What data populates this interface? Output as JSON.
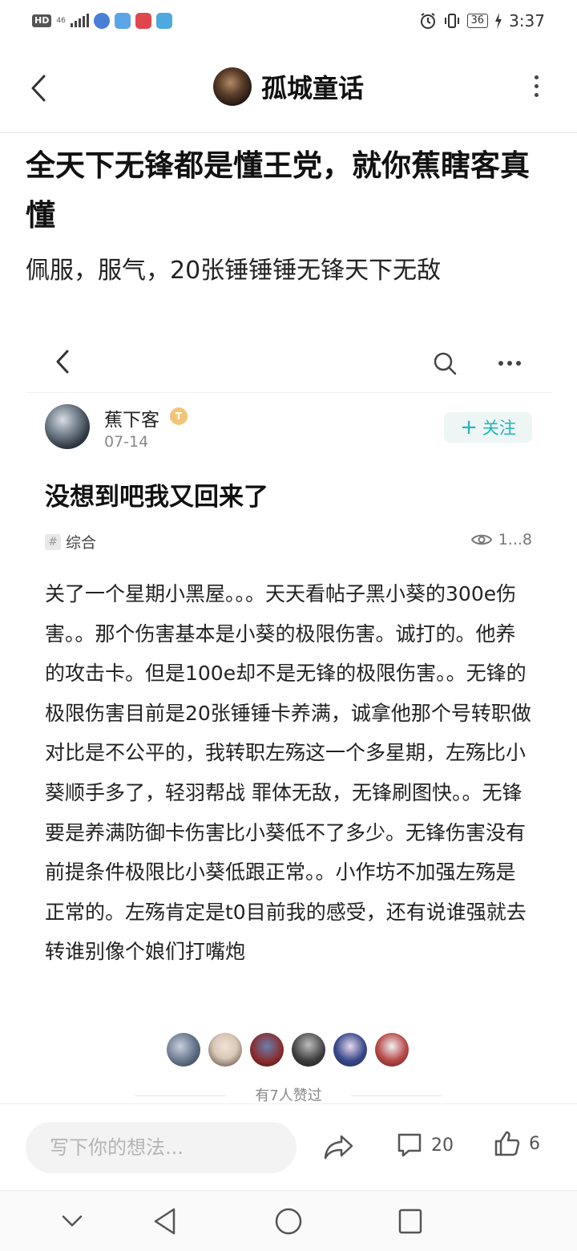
{
  "status_bar": {
    "hd": "HD",
    "network": "46",
    "battery": "36",
    "time": "3:37",
    "app_icon_colors": [
      "#4a7fd8",
      "#5aa6e6",
      "#e0474c",
      "#4fa8e0"
    ]
  },
  "header": {
    "title": "孤城童话"
  },
  "post": {
    "title": "全天下无锋都是懂王党，就你蕉瞎客真懂",
    "subtitle": "佩服，服气，20张锤锤锤无锋天下无敌"
  },
  "embedded": {
    "author": "蕉下客",
    "author_badge": "T5",
    "date": "07-14",
    "follow_label": "关注",
    "title": "没想到吧我又回来了",
    "tag": "综合",
    "views": "1...8",
    "body": "关了一个星期小黑屋。。。天天看帖子黑小葵的300e伤害。。那个伤害基本是小葵的极限伤害。诚打的。他养的攻击卡。但是100e却不是无锋的极限伤害。。无锋的极限伤害目前是20张锤锤卡养满，诚拿他那个号转职做对比是不公平的，我转职左殇这一个多星期，左殇比小葵顺手多了，轻羽帮战 罪体无敌，无锋刷图快。。无锋要是养满防御卡伤害比小葵低不了多少。无锋伤害没有前提条件极限比小葵低跟正常。。小作坊不加强左殇是正常的。左殇肯定是t0目前我的感受，还有说谁强就去转谁别像个娘们打嘴炮",
    "liked_text": "有7人赞过",
    "liker_colors": [
      "#5b6a80",
      "#d9c8b8",
      "#8a2a2a",
      "#3b3b3b",
      "#3a4a8a",
      "#b84848"
    ]
  },
  "bottom_bar": {
    "input_placeholder": "写下你的想法...",
    "comment_count": "20",
    "like_count": "6"
  },
  "icons": {
    "back": "back-arrow-icon",
    "more": "more-vertical-icon",
    "share": "share-icon",
    "comment": "comment-icon",
    "like": "thumbs-up-icon"
  }
}
